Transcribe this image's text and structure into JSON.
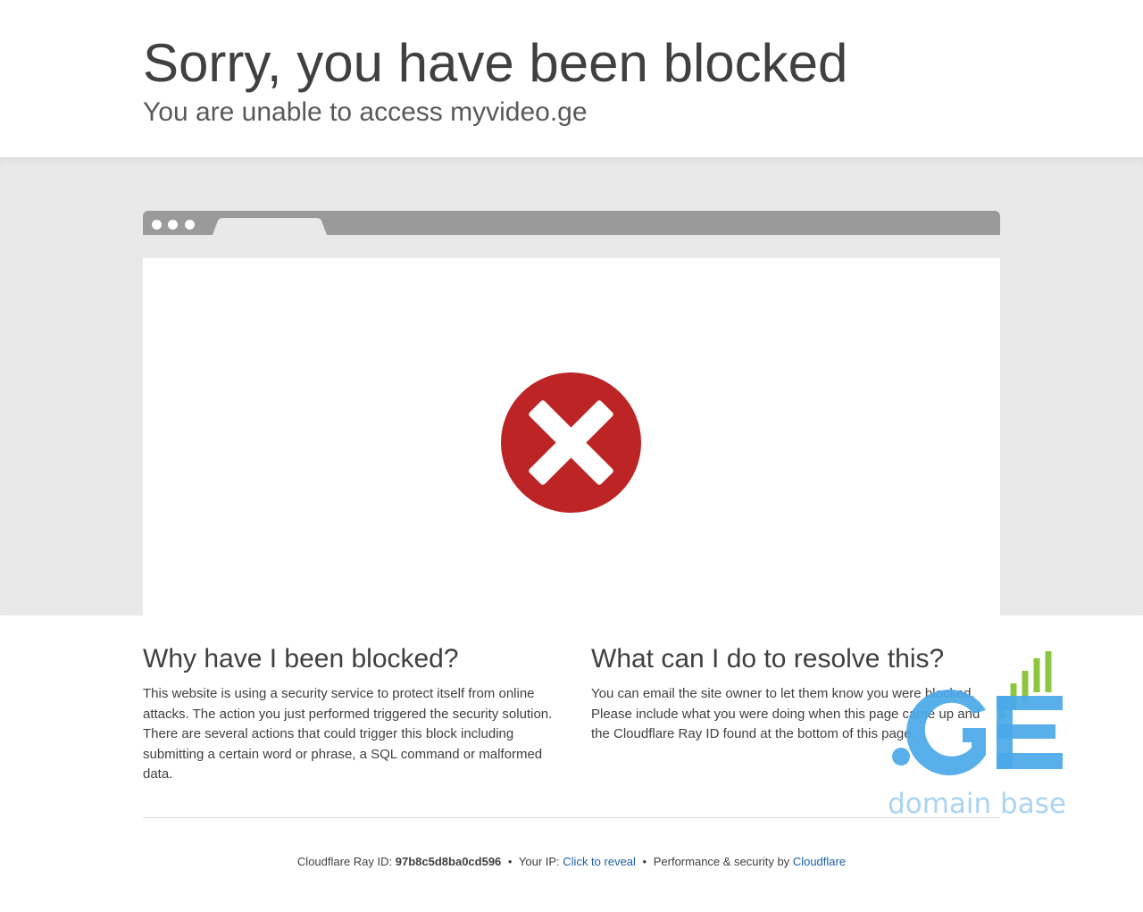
{
  "header": {
    "title": "Sorry, you have been blocked",
    "subtitle": "You are unable to access myvideo.ge"
  },
  "sections": {
    "why": {
      "heading": "Why have I been blocked?",
      "body": "This website is using a security service to protect itself from online attacks. The action you just performed triggered the security solution. There are several actions that could trigger this block including submitting a certain word or phrase, a SQL command or malformed data."
    },
    "resolve": {
      "heading": "What can I do to resolve this?",
      "body": "You can email the site owner to let them know you were blocked. Please include what you were doing when this page came up and the Cloudflare Ray ID found at the bottom of this page."
    }
  },
  "footer": {
    "ray_label": "Cloudflare Ray ID:",
    "ray_id": "97b8c5d8ba0cd596",
    "bullet": "•",
    "ip_label": "Your IP:",
    "ip_link": "Click to reveal",
    "perf_label": "Performance & security by",
    "perf_link": "Cloudflare"
  },
  "overlay_logo": {
    "mark": ".GE",
    "tagline": "domain base"
  },
  "icons": {
    "error": "error-x-icon"
  },
  "colors": {
    "error_red": "#bd2426",
    "link_blue": "#1a5fa8",
    "logo_blue": "#4aa8e8",
    "logo_green": "#8cc63f"
  }
}
